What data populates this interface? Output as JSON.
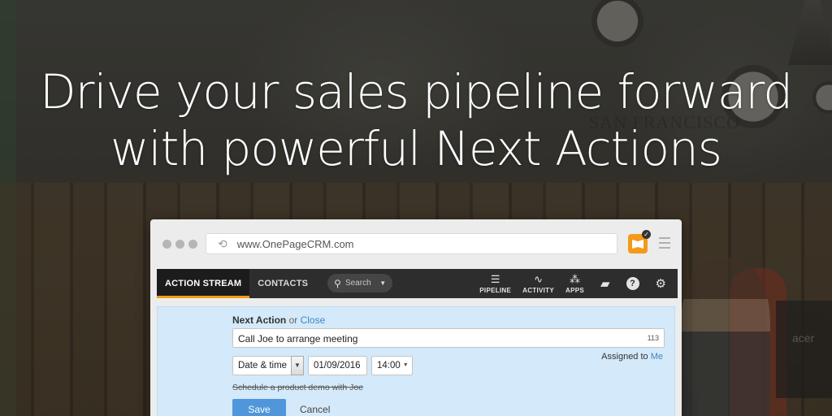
{
  "headline": {
    "line1": "Drive your sales pipeline forward",
    "line2": "with powerful Next Actions"
  },
  "background": {
    "sign_text": "SAN FRANCISCO",
    "monitor_brand": "acer"
  },
  "browser": {
    "url": "www.OnePageCRM.com",
    "icons": {
      "reload": "reload-icon",
      "extension": "onepagecrm-extension-icon",
      "menu": "hamburger-menu-icon"
    }
  },
  "appnav": {
    "tabs": [
      {
        "label": "ACTION STREAM",
        "active": true
      },
      {
        "label": "CONTACTS",
        "active": false
      }
    ],
    "search": {
      "placeholder": "Search"
    },
    "right_items": [
      {
        "label": "PIPELINE",
        "icon": "filter-icon"
      },
      {
        "label": "ACTIVITY",
        "icon": "pulse-icon"
      },
      {
        "label": "APPS",
        "icon": "apps-icon"
      }
    ],
    "utility_icons": [
      "chat-icon",
      "help-icon",
      "gear-icon"
    ],
    "accent_color": "#f39a1b"
  },
  "form": {
    "title": "Next Action",
    "or_text": "or",
    "close_label": "Close",
    "action_text": "Call Joe to arrange meeting",
    "char_count": "113",
    "assigned_label": "Assigned to",
    "assigned_user": "Me",
    "date_type": "Date & time",
    "date_value": "01/09/2016",
    "time_value": "14:00",
    "completed_action": "Schedule a product demo with Joe",
    "save_label": "Save",
    "cancel_label": "Cancel",
    "panel_color": "#d4e9f9",
    "save_color": "#4f96da"
  }
}
